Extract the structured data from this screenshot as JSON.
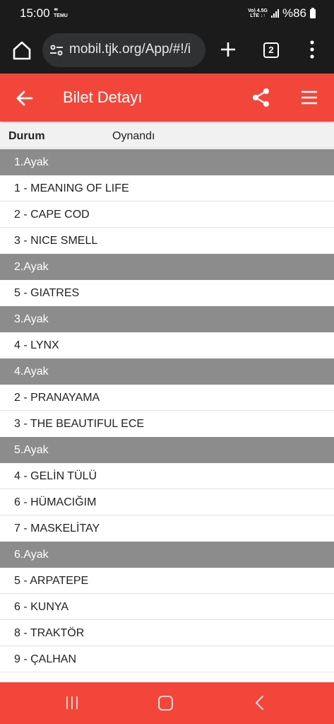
{
  "status_bar": {
    "time": "15:00",
    "mini_icons": [
      "ᄈ",
      "TEMU"
    ],
    "net_top": "Vo) 4.5G",
    "net_bottom": "LTE ↓↑",
    "battery": "%86"
  },
  "browser": {
    "url": "mobil.tjk.org/App/#!/i",
    "tab_count": "2"
  },
  "header": {
    "title": "Bilet Detayı"
  },
  "ticket": {
    "status_label": "Durum",
    "status_value": "Oynandı"
  },
  "legs": [
    {
      "title": "1.Ayak",
      "horses": [
        "1 - MEANING OF LIFE",
        "2 - CAPE COD",
        "3 - NICE SMELL"
      ]
    },
    {
      "title": "2.Ayak",
      "horses": [
        "5 - GIATRES"
      ]
    },
    {
      "title": "3.Ayak",
      "horses": [
        "4 - LYNX"
      ]
    },
    {
      "title": "4.Ayak",
      "horses": [
        "2 - PRANAYAMA",
        "3 - THE BEAUTIFUL ECE"
      ]
    },
    {
      "title": "5.Ayak",
      "horses": [
        "4 - GELİN TÜLÜ",
        "6 - HÜMACIĞIM",
        "7 - MASKELİTAY"
      ]
    },
    {
      "title": "6.Ayak",
      "horses": [
        "5 - ARPATEPE",
        "6 - KUNYA",
        "8 - TRAKTÖR",
        "9 - ÇALHAN"
      ]
    }
  ],
  "colors": {
    "header_bg": "#f2463a",
    "leg_header_bg": "#8c8c8c",
    "system_bar_bg": "#1b1b1b"
  }
}
